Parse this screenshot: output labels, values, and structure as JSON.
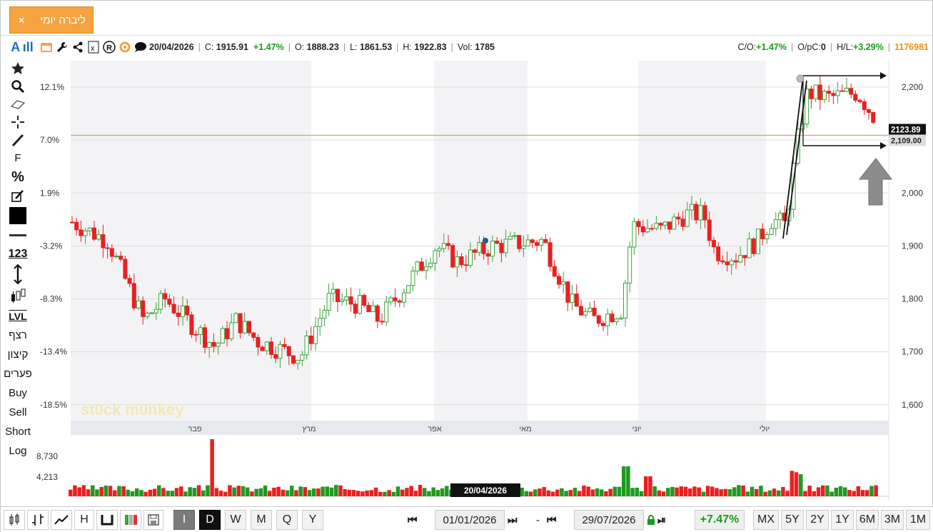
{
  "tab": {
    "title": "ליברה יומי",
    "close": "×"
  },
  "header": {
    "logo": "A ıll",
    "date": "20/04/2026",
    "close_label": "C:",
    "close_value": "1915.91",
    "change_pct": "+1.47%",
    "open_label": "O:",
    "open_value": "1888.23",
    "low_label": "L:",
    "low_value": "1861.53",
    "high_label": "H:",
    "high_value": "1922.83",
    "vol_label": "Vol:",
    "vol_value": "1785",
    "co_label": "C/O:",
    "co_value": "+1.47%",
    "opc_label": "O/pC:",
    "opc_value": "0",
    "hl_label": "H/L:",
    "hl_value": "+3.29%",
    "id_value": "1176981",
    "icons": [
      "calendar-icon",
      "wrench-icon",
      "share-icon",
      "excel-icon",
      "registered-icon",
      "target-icon",
      "comment-icon"
    ]
  },
  "left_toolbar": {
    "f_label": "F",
    "pct_label": "%",
    "num_label": "123",
    "lvl_label": "LVL",
    "items": [
      "רצף",
      "קיצון",
      "פערים",
      "Buy",
      "Sell",
      "Short",
      "Log"
    ]
  },
  "chart_data": {
    "type": "candlestick",
    "y_ticks": [
      "2,200",
      "2,100",
      "2,000",
      "1,900",
      "1,800",
      "1,700",
      "1,600"
    ],
    "pct_ticks": [
      "12.1%",
      "7.0%",
      "1.9%",
      "-3.2%",
      "-8.3%",
      "-13.4%",
      "-18.5%"
    ],
    "months": [
      "פבר",
      "מרץ",
      "אפר",
      "מאי",
      "יוני",
      "יולי"
    ],
    "last_price": "2123.89",
    "line_price": "2,109.00",
    "volume_ticks": [
      "8,730",
      "4,213"
    ],
    "crosshair_date": "20/04/2026",
    "watermark": "st0ck m0nkey",
    "ylim": [
      1570,
      2250
    ]
  },
  "bottombar": {
    "intervals": [
      "I",
      "D",
      "W",
      "M",
      "Q",
      "Y"
    ],
    "active_interval": "D",
    "start_date": "01/01/2026",
    "end_date": "29/07/2026",
    "dash": "-",
    "period_change": "+7.47%",
    "ranges": [
      "MX",
      "5Y",
      "2Y",
      "1Y",
      "6M",
      "3M",
      "1M"
    ],
    "h_label": "H"
  }
}
